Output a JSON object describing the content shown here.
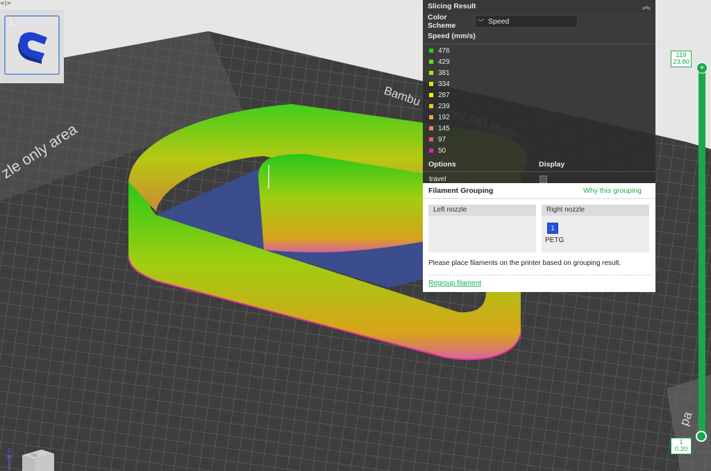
{
  "window": {
    "collapse_toggle": "<|>"
  },
  "thumbnail": {
    "plate_index": "1"
  },
  "bed": {
    "label_left": "zle only area",
    "label_right": "Bambu Textured PEI Plate",
    "label_corner": "pa"
  },
  "slicing_result": {
    "title": "Slicing Result",
    "color_scheme_label": "Color Scheme",
    "color_scheme_value": "Speed",
    "legend_title": "Speed (mm/s)",
    "legend": [
      {
        "value": "476",
        "color": "#22d41a"
      },
      {
        "value": "429",
        "color": "#5fe014"
      },
      {
        "value": "381",
        "color": "#9be90f"
      },
      {
        "value": "334",
        "color": "#d4ee0c"
      },
      {
        "value": "287",
        "color": "#f4ee0a"
      },
      {
        "value": "239",
        "color": "#f8c010"
      },
      {
        "value": "192",
        "color": "#f5a24a"
      },
      {
        "value": "145",
        "color": "#f07a73"
      },
      {
        "value": "97",
        "color": "#ee4f9a"
      },
      {
        "value": "50",
        "color": "#e21ad8"
      }
    ],
    "options_header": "Options",
    "display_header": "Display",
    "options": [
      {
        "label": "travel",
        "checked": false
      }
    ]
  },
  "filament_grouping": {
    "title": "Filament Grouping",
    "why_link": "Why this grouping",
    "left_nozzle": "Left nozzle",
    "right_nozzle": "Right nozzle",
    "right_filament_index": "1",
    "right_filament_name": "PETG",
    "right_filament_color": "#2453d6",
    "note": "Please place filaments on the printer based on grouping result.",
    "regroup_link": "Regroup filament"
  },
  "layer_slider": {
    "top_layer": "119",
    "top_height": "23.80",
    "bottom_layer": "1",
    "bottom_height": "0.20",
    "top_button": "+",
    "accent": "#1aa84a"
  },
  "gizmo": {
    "z_label": "Z",
    "cube_label": "Top"
  }
}
